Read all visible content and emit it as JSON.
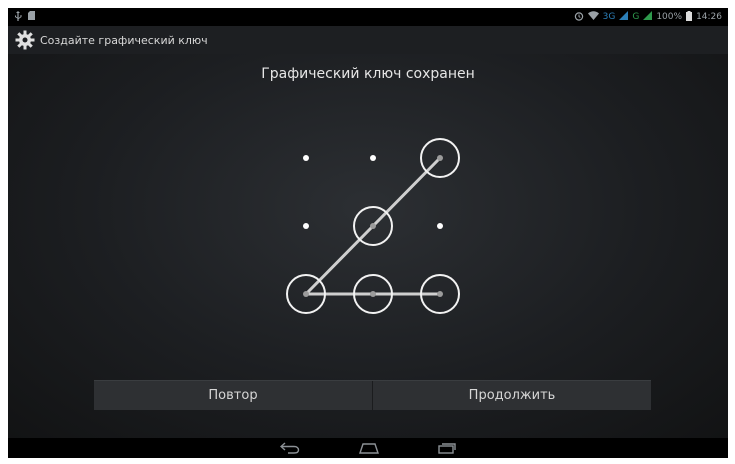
{
  "status_bar": {
    "left_icons": [
      "usb-icon",
      "sd-icon"
    ],
    "right": {
      "alarm_icon": "alarm-icon",
      "wifi_icon": "wifi-icon",
      "network_3g": "3G",
      "network_g": "G",
      "signal_icon": "signal-icon",
      "battery": "100%",
      "time": "14:26"
    }
  },
  "action_bar": {
    "icon": "gear-icon",
    "title": "Создайте графический ключ"
  },
  "pattern": {
    "title": "Графический ключ сохранен",
    "grid": [
      [
        0,
        0,
        1
      ],
      [
        0,
        1,
        0
      ],
      [
        1,
        1,
        1
      ]
    ]
  },
  "buttons": {
    "retry": "Повтор",
    "continue": "Продолжить"
  },
  "nav_bar": {
    "back_icon": "back-icon",
    "home_icon": "home-icon",
    "recents_icon": "recents-icon"
  },
  "colors": {
    "background": "#1c1e21",
    "accent_green": "#2f9a4d",
    "accent_blue": "#2c7fb8",
    "pattern_line": "#cfcfcf"
  }
}
